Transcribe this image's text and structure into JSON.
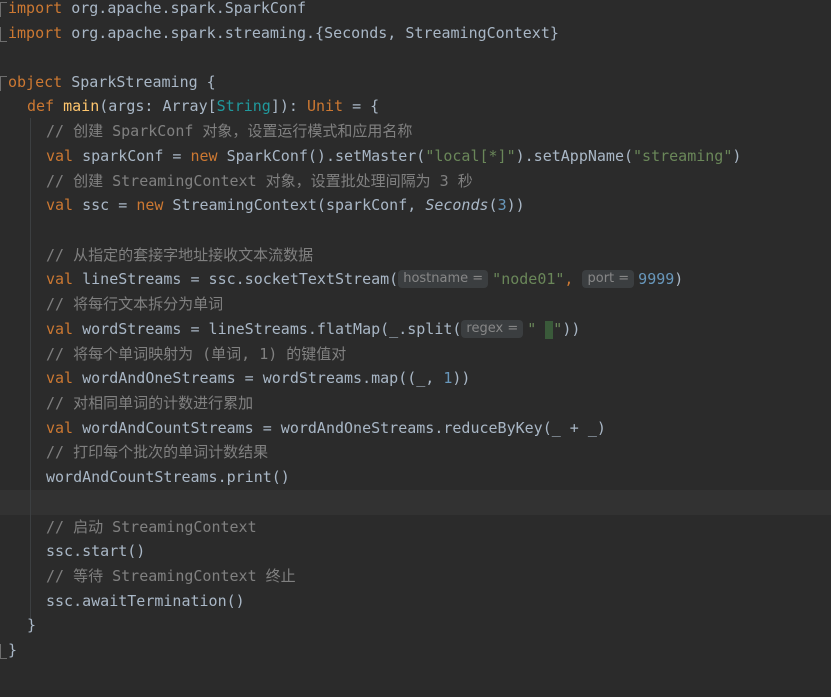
{
  "editor": {
    "lines": {
      "l1": {
        "kw": "import",
        "rest": " org.apache.spark.SparkConf"
      },
      "l2": {
        "kw": "import",
        "rest": " org.apache.spark.streaming.{Seconds, StreamingContext}"
      },
      "l4": {
        "kw": "object",
        "rest": " SparkStreaming {"
      },
      "l5": {
        "kw": "def",
        "fn": "main",
        "p1": "(args: Array[",
        "type": "String",
        "p2": "]): ",
        "unit": "Unit",
        "p3": " = {"
      },
      "l6": {
        "cm": "// 创建 SparkConf 对象，设置运行模式和应用名称"
      },
      "l7": {
        "kw": "val",
        "a": " sparkConf = ",
        "new": "new",
        "b": " SparkConf().setMaster(",
        "s1": "\"local[*]\"",
        "c": ").setAppName(",
        "s2": "\"streaming\"",
        "d": ")"
      },
      "l8": {
        "cm": "// 创建 StreamingContext 对象，设置批处理间隔为 3 秒"
      },
      "l9": {
        "kw": "val",
        "a": " ssc = ",
        "new": "new",
        "b": " StreamingContext(sparkConf, ",
        "it": "Seconds",
        "c": "(",
        "num": "3",
        "d": "))"
      },
      "l11": {
        "cm": "// 从指定的套接字地址接收文本流数据"
      },
      "l12": {
        "kw": "val",
        "a": " lineStreams = ssc.socketTextStream(",
        "hint1": "hostname =",
        "s1": "\"node01\"",
        "b": ", ",
        "hint2": "port =",
        "num": "9999",
        "c": ")"
      },
      "l13": {
        "cm": "// 将每行文本拆分为单词"
      },
      "l14": {
        "kw": "val",
        "a": " wordStreams = lineStreams.flatMap(_.split(",
        "hint": "regex =",
        "s1": "\" ",
        "s2": "\"",
        "b": "))"
      },
      "l15": {
        "cm": "// 将每个单词映射为 (单词, 1) 的键值对"
      },
      "l16": {
        "kw": "val",
        "a": " wordAndOneStreams = wordStreams.map((_, ",
        "num": "1",
        "b": "))"
      },
      "l17": {
        "cm": "// 对相同单词的计数进行累加"
      },
      "l18": {
        "kw": "val",
        "a": " wordAndCountStreams = wordAndOneStreams.reduceByKey(_ + _)"
      },
      "l19": {
        "cm": "// 打印每个批次的单词计数结果"
      },
      "l20": {
        "text": "wordAndCountStreams.print()"
      },
      "l22": {
        "cm": "// 启动 StreamingContext"
      },
      "l23": {
        "text": "ssc.start()"
      },
      "l24": {
        "cm": "// 等待 StreamingContext 终止"
      },
      "l25": {
        "text": "ssc.awaitTermination()"
      },
      "l26": {
        "text": "}"
      },
      "l27": {
        "text": "}"
      }
    }
  }
}
